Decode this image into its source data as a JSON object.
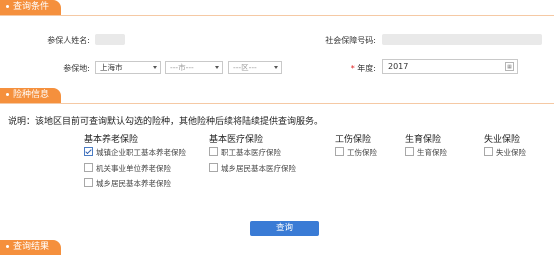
{
  "sections": {
    "query_conditions": "查询条件",
    "insurance_types": "险种信息",
    "query_results": "查询结果"
  },
  "form": {
    "name_label": "参保人姓名:",
    "ssn_label": "社会保障号码:",
    "location_label": "参保地:",
    "province_value": "上海市",
    "city_placeholder": "---市---",
    "district_placeholder": "---区---",
    "year_required_mark": "*",
    "year_label": "年度:",
    "year_value": "2017",
    "calendar_icon": "calendar-icon"
  },
  "notice": "说明：该地区目前可查询默认勾选的险种，其他险种后续将陆续提供查询服务。",
  "categories": {
    "pension": "基本养老保险",
    "medical": "基本医疗保险",
    "injury": "工伤保险",
    "maternity": "生育保险",
    "unemployment": "失业保险"
  },
  "items": {
    "pension_enterprise": "城镇企业职工基本养老保险",
    "pension_institution": "机关事业单位养老保险",
    "pension_resident": "城乡居民基本养老保险",
    "medical_employee": "职工基本医疗保险",
    "medical_resident": "城乡居民基本医疗保险",
    "injury": "工伤保险",
    "maternity": "生育保险",
    "unemployment": "失业保险"
  },
  "checked": {
    "pension_enterprise": true
  },
  "query_button": "查询",
  "colors": {
    "section_tab": "#f5903d",
    "button": "#3a7bd5"
  }
}
